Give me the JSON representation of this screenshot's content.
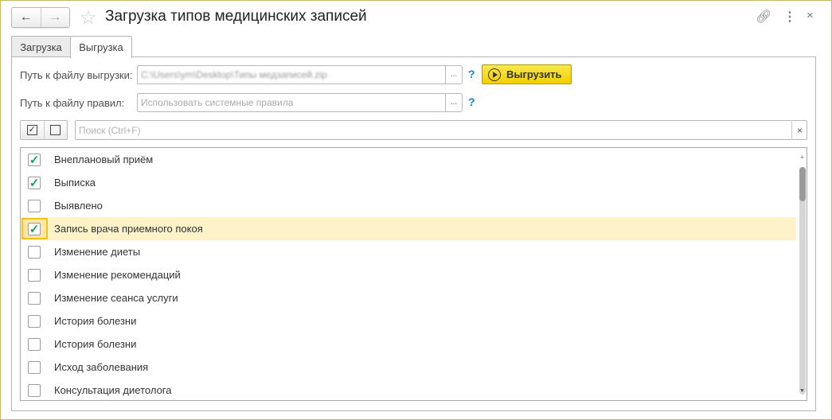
{
  "window": {
    "title": "Загрузка типов медицинских записей"
  },
  "tabs": [
    {
      "label": "Загрузка",
      "active": false
    },
    {
      "label": "Выгрузка",
      "active": true
    }
  ],
  "export_path": {
    "label": "Путь к файлу выгрузки:",
    "value": "C:\\Users\\ym\\Desktop\\Типы медзаписей.zip",
    "browse": "...",
    "help": "?"
  },
  "rules_path": {
    "label": "Путь к файлу правил:",
    "placeholder": "Использовать системные правила",
    "browse": "...",
    "help": "?"
  },
  "export_button": {
    "label": "Выгрузить"
  },
  "search": {
    "placeholder": "Поиск (Ctrl+F)",
    "clear": "×"
  },
  "list": {
    "items": [
      {
        "label": "Внеплановый приём",
        "checked": true
      },
      {
        "label": "Выписка",
        "checked": true
      },
      {
        "label": "Выявлено",
        "checked": false
      },
      {
        "label": "Запись врача приемного покоя",
        "checked": true,
        "selected": true
      },
      {
        "label": "Изменение диеты",
        "checked": false
      },
      {
        "label": "Изменение рекомендаций",
        "checked": false
      },
      {
        "label": "Изменение сеанса услуги",
        "checked": false
      },
      {
        "label": "История болезни",
        "checked": false
      },
      {
        "label": "История болезни",
        "checked": false
      },
      {
        "label": "Исход заболевания",
        "checked": false
      },
      {
        "label": "Консультация диетолога",
        "checked": false
      }
    ]
  },
  "colors": {
    "accent": "#f2cf00",
    "selection": "#fdf2c8",
    "check": "#1aa05a",
    "help": "#1f7fc7"
  }
}
